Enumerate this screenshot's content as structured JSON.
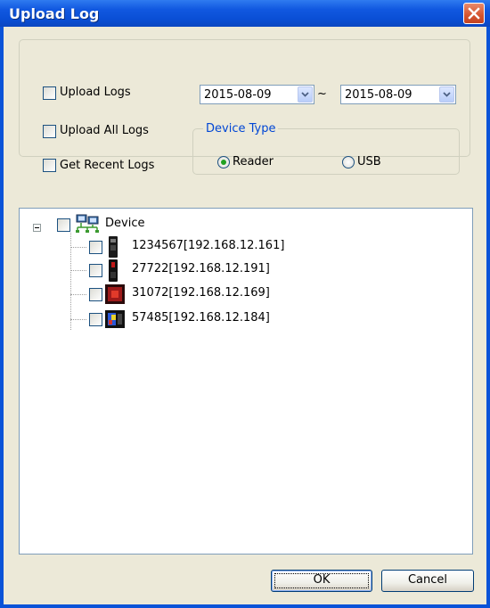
{
  "window": {
    "title": "Upload Log"
  },
  "options": {
    "upload_logs": {
      "label": "Upload Logs",
      "checked": false
    },
    "upload_all_logs": {
      "label": "Upload All Logs",
      "checked": false
    },
    "get_recent_logs": {
      "label": "Get Recent Logs",
      "checked": false
    }
  },
  "date_range": {
    "from": "2015-08-09",
    "separator": "~",
    "to": "2015-08-09"
  },
  "device_type": {
    "legend": "Device Type",
    "options": [
      {
        "label": "Reader",
        "selected": true
      },
      {
        "label": "USB",
        "selected": false
      }
    ]
  },
  "tree": {
    "root": {
      "label": "Device",
      "icon": "network-computers-icon",
      "expanded": true,
      "checked": false
    },
    "children": [
      {
        "label": "1234567[192.168.12.161]",
        "icon": "reader-black-icon",
        "checked": false
      },
      {
        "label": "27722[192.168.12.191]",
        "icon": "reader-black-red-icon",
        "checked": false
      },
      {
        "label": "31072[192.168.12.169]",
        "icon": "reader-red-icon",
        "checked": false
      },
      {
        "label": "57485[192.168.12.184]",
        "icon": "reader-color-screen-icon",
        "checked": false
      }
    ]
  },
  "buttons": {
    "ok": "OK",
    "cancel": "Cancel"
  },
  "colors": {
    "titlebar": "#0a4fd6",
    "dialog_bg": "#ece9d8",
    "legend_text": "#0046d5",
    "radio_dot": "#21a121"
  }
}
